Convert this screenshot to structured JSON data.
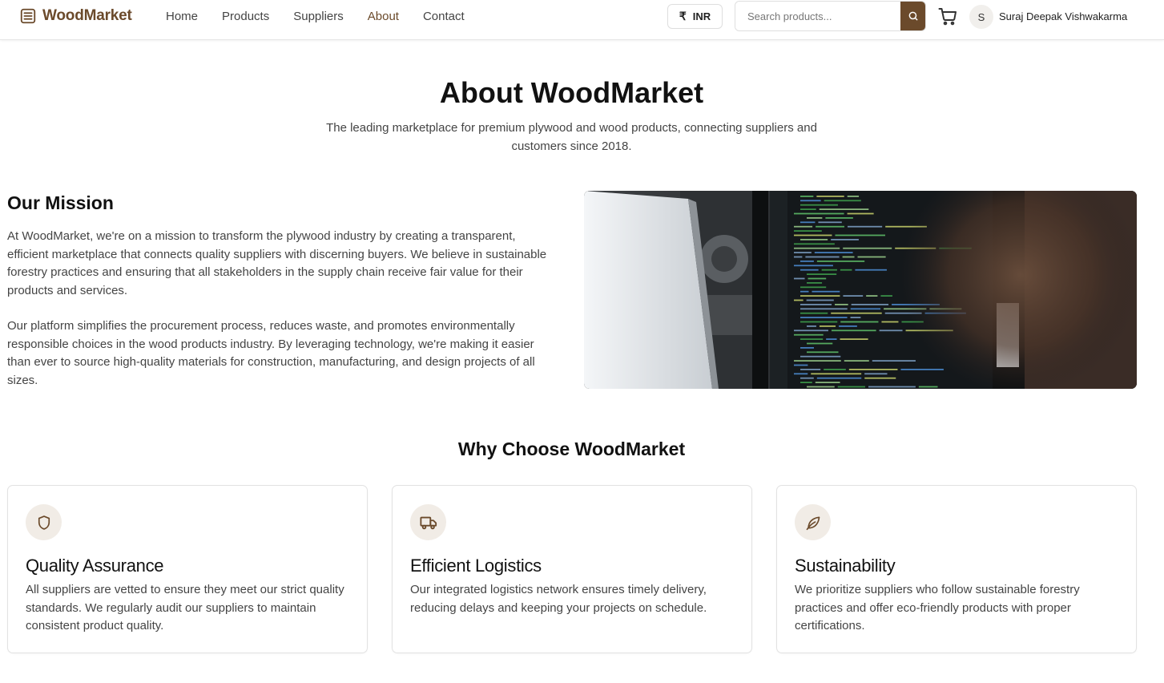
{
  "header": {
    "brand": "WoodMarket",
    "nav": [
      {
        "label": "Home"
      },
      {
        "label": "Products"
      },
      {
        "label": "Suppliers"
      },
      {
        "label": "About",
        "active": true
      },
      {
        "label": "Contact"
      }
    ],
    "currency": {
      "symbol": "₹",
      "code": "INR"
    },
    "search": {
      "placeholder": "Search products..."
    },
    "user": {
      "initial": "S",
      "name": "Suraj Deepak Vishwakarma"
    }
  },
  "hero": {
    "title": "About WoodMarket",
    "subtitle": "The leading marketplace for premium plywood and wood products, connecting suppliers and customers since 2018."
  },
  "mission": {
    "title": "Our Mission",
    "paragraphs": [
      "At WoodMarket, we're on a mission to transform the plywood industry by creating a transparent, efficient marketplace that connects quality suppliers with discerning buyers. We believe in sustainable forestry practices and ensuring that all stakeholders in the supply chain receive fair value for their products and services.",
      "Our platform simplifies the procurement process, reduces waste, and promotes environmentally responsible choices in the wood products industry. By leveraging technology, we're making it easier than ever to source high-quality materials for construction, manufacturing, and design projects of all sizes."
    ]
  },
  "why": {
    "title": "Why Choose WoodMarket",
    "features": [
      {
        "icon": "shield-icon",
        "title": "Quality Assurance",
        "text": "All suppliers are vetted to ensure they meet our strict quality standards. We regularly audit our suppliers to maintain consistent product quality."
      },
      {
        "icon": "truck-icon",
        "title": "Efficient Logistics",
        "text": "Our integrated logistics network ensures timely delivery, reducing delays and keeping your projects on schedule."
      },
      {
        "icon": "leaf-icon",
        "title": "Sustainability",
        "text": "We prioritize suppliers who follow sustainable forestry practices and offer eco-friendly products with proper certifications."
      }
    ]
  },
  "colors": {
    "brand": "#6b4a2b",
    "icon_bg": "#f1ece6",
    "text_muted": "#444444"
  }
}
